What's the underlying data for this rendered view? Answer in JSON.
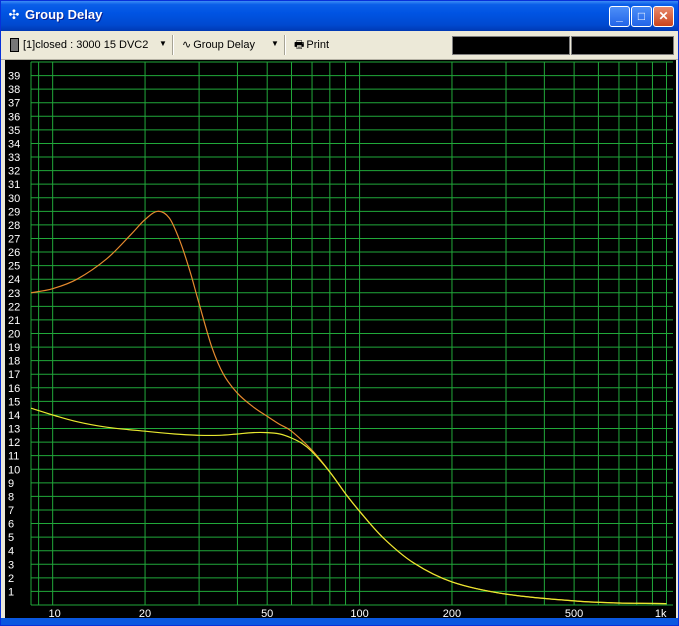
{
  "window": {
    "title": "Group Delay"
  },
  "toolbar": {
    "curve_select": "[1]closed : 3000 15 DVC2",
    "view_select": "Group Delay",
    "print_label": "Print"
  },
  "colors": {
    "curve_orange": "#e68a2e",
    "curve_yellow": "#e8e830",
    "grid": "#21a83a",
    "axis_text": "#ffffff"
  },
  "chart_data": {
    "type": "line",
    "title": "",
    "xlabel": "",
    "ylabel": "",
    "x_scale": "log",
    "xlim": [
      8.5,
      1050
    ],
    "ylim": [
      0,
      40
    ],
    "grid": true,
    "x_tick_labels": [
      "10",
      "20",
      "50",
      "100",
      "200",
      "500",
      "1k"
    ],
    "y_tick_labels": [
      "1",
      "2",
      "3",
      "4",
      "5",
      "6",
      "7",
      "8",
      "9",
      "10",
      "11",
      "12",
      "13",
      "14",
      "15",
      "16",
      "17",
      "18",
      "19",
      "20",
      "21",
      "22",
      "23",
      "24",
      "25",
      "26",
      "27",
      "28",
      "29",
      "30",
      "31",
      "32",
      "33",
      "34",
      "35",
      "36",
      "37",
      "38",
      "39"
    ],
    "series": [
      {
        "color": "#e68a2e",
        "x": [
          8.5,
          10,
          12,
          15,
          18,
          20,
          22,
          24,
          26,
          28,
          30,
          33,
          36,
          40,
          45,
          50,
          55,
          60,
          70,
          80,
          90,
          100,
          120,
          150,
          200,
          300,
          500,
          700,
          1000
        ],
        "y": [
          23.0,
          23.3,
          24.0,
          25.5,
          27.3,
          28.4,
          29.0,
          28.5,
          26.8,
          24.6,
          22.2,
          19.0,
          17.0,
          15.6,
          14.6,
          13.9,
          13.3,
          12.8,
          11.4,
          9.8,
          8.2,
          6.9,
          4.9,
          3.1,
          1.7,
          0.8,
          0.3,
          0.15,
          0.1
        ]
      },
      {
        "color": "#e8e830",
        "x": [
          8.5,
          10,
          12,
          15,
          20,
          25,
          30,
          35,
          40,
          45,
          50,
          55,
          60,
          65,
          70,
          80,
          90,
          100,
          120,
          150,
          200,
          300,
          500,
          700,
          1000
        ],
        "y": [
          14.5,
          14.0,
          13.5,
          13.1,
          12.8,
          12.6,
          12.5,
          12.5,
          12.6,
          12.7,
          12.7,
          12.6,
          12.3,
          11.9,
          11.3,
          9.8,
          8.2,
          6.9,
          4.9,
          3.1,
          1.7,
          0.8,
          0.3,
          0.15,
          0.1
        ]
      }
    ]
  }
}
